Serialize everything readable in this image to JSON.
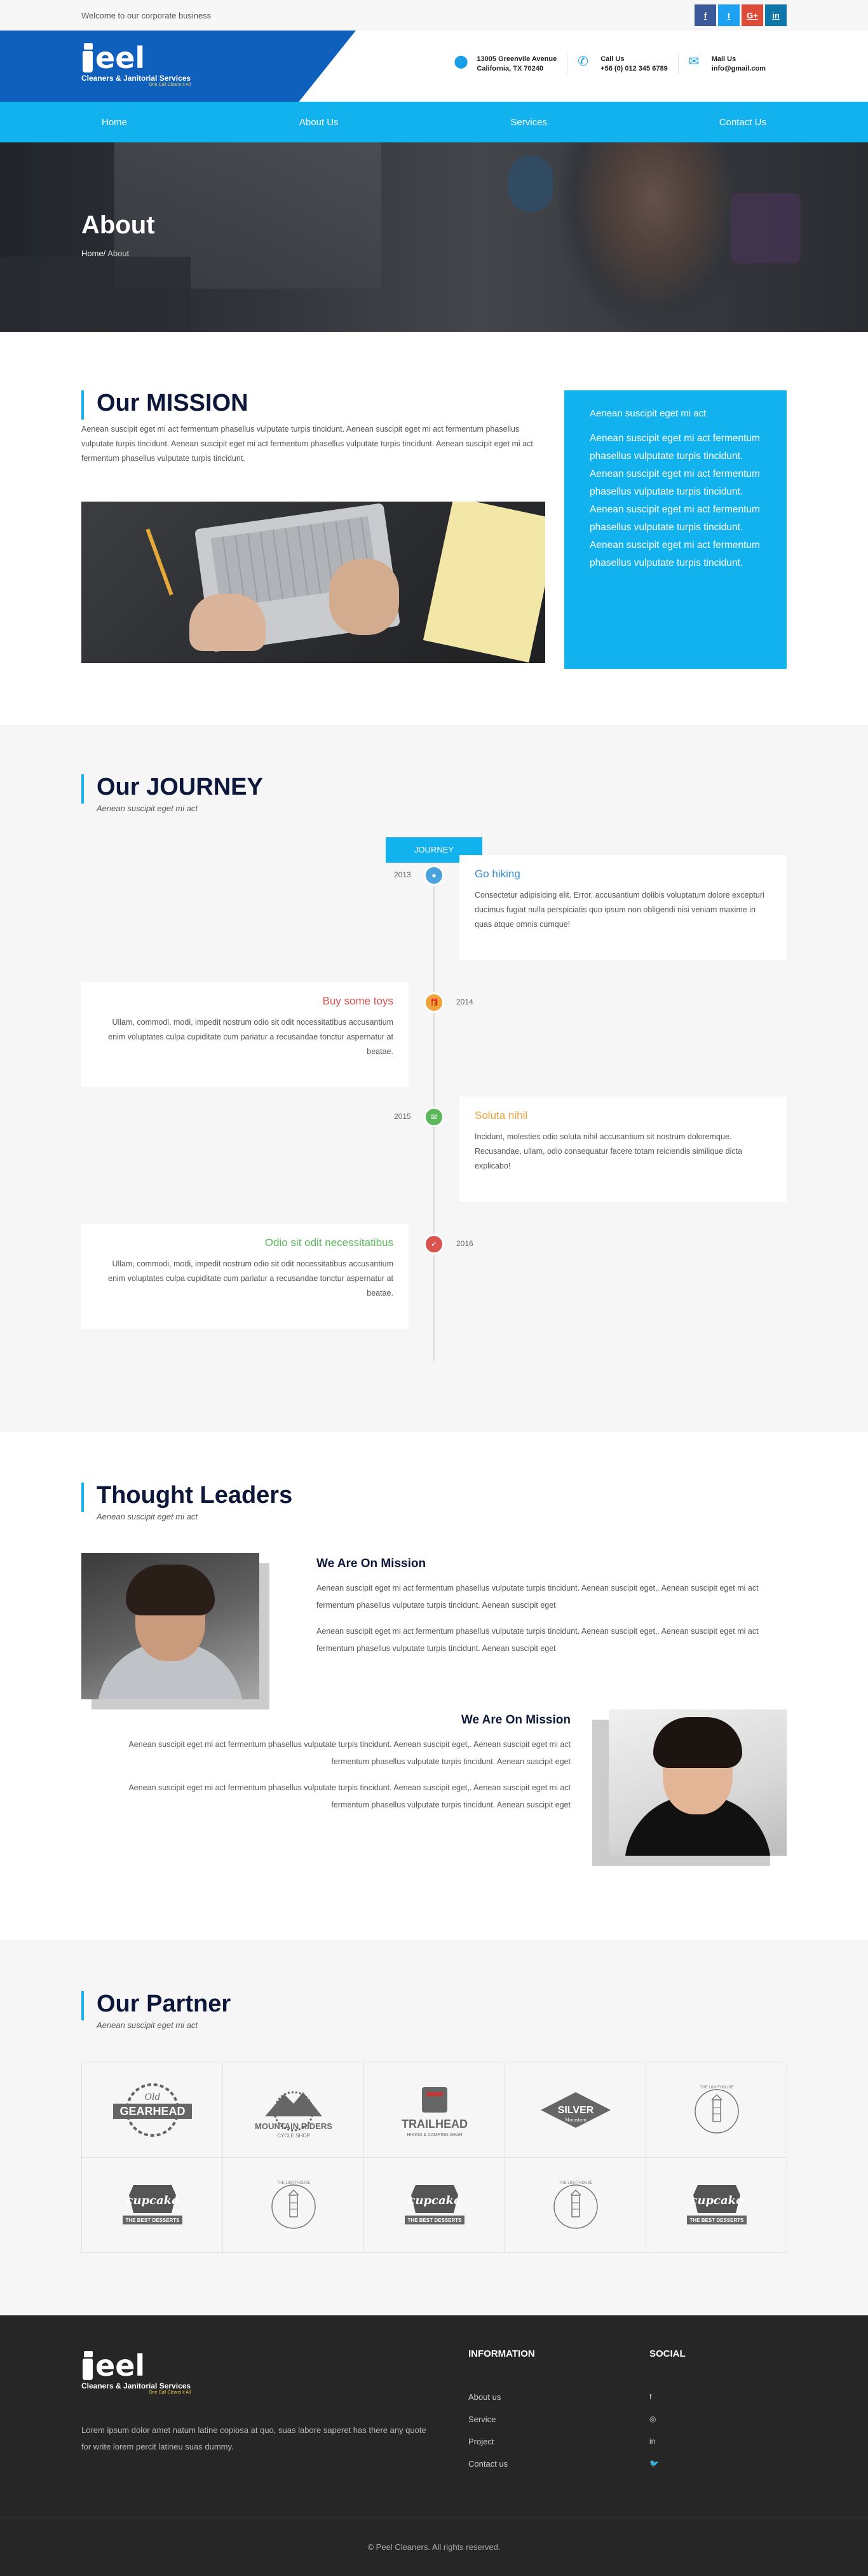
{
  "topbar": {
    "welcome": "Welcome to our corporate business",
    "social": [
      {
        "label": "f",
        "color": "#3b5998"
      },
      {
        "label": "t",
        "color": "#1da1f2"
      },
      {
        "label": "G+",
        "color": "#dd4b39"
      },
      {
        "label": "in",
        "color": "#0e76a8"
      }
    ]
  },
  "logo": {
    "word": "eel",
    "tagline": "Cleaners & Janitorial Services",
    "slogan": "One Call Cleans it All"
  },
  "contacts": [
    {
      "icon": "map-pin-icon",
      "line1": "13005 Greenvile Avenue",
      "line2": "California, TX 70240"
    },
    {
      "icon": "phone-icon",
      "line1": "Call Us",
      "line2": "+56 (0) 012 345 6789"
    },
    {
      "icon": "mail-icon",
      "line1": "Mail Us",
      "line2": "info@gmail.com"
    }
  ],
  "nav": [
    "Home",
    "About Us",
    "Services",
    "Contact Us"
  ],
  "hero": {
    "title": "About",
    "crumb_home": "Home/",
    "crumb_current": " About"
  },
  "mission": {
    "title": "Our MISSION",
    "paragraph": "Aenean suscipit eget mi act fermentum phasellus vulputate turpis tincidunt. Aenean suscipit eget mi act fermentum phasellus vulputate turpis tincidunt. Aenean suscipit eget mi act fermentum phasellus vulputate turpis tincidunt. Aenean suscipit eget mi act fermentum phasellus vulputate turpis tincidunt.",
    "box_heading": "Aenean suscipit eget mi act",
    "box_text": "Aenean suscipit eget mi act fermentum phasellus vulputate turpis tincidunt. Aenean suscipit eget mi act fermentum phasellus vulputate turpis tincidunt. Aenean suscipit eget mi act fermentum phasellus vulputate turpis tincidunt. Aenean suscipit eget mi act fermentum phasellus vulputate turpis tincidunt."
  },
  "journey": {
    "title": "Our JOURNEY",
    "subtitle": "Aenean suscipit eget mi act",
    "button": "JOURNEY",
    "items": [
      {
        "year": "2013",
        "title": "Go hiking",
        "color": "#4aa3df",
        "icon": "circle-icon",
        "text": "Consectetur adipisicing elit. Error, accusantium dolibis voluptatum dolore excepturi ducimus fugiat nulla perspiciatis quo ipsum non obligendi nisi veniam maxime in quas atque omnis cumque!"
      },
      {
        "year": "2014",
        "title": "Buy some toys",
        "color": "#f0a33b",
        "icon": "gift-icon",
        "text": "Ullam, commodi, modi, impedit nostrum odio sit odit nocessitatibus accusantium enim voluptates culpa cupiditate cum pariatur a recusandae tonctur aspernatur at beatae."
      },
      {
        "year": "2015",
        "title": "Soluta nihil",
        "color": "#5cb85c",
        "icon": "chat-icon",
        "text": "Incidunt, molesties odio soluta nihil accusantium sit nostrum doloremque. Recusandae, ullam, odio consequatur facere totam reiciendis similique dicta explicabo!"
      },
      {
        "year": "2016",
        "title": "Odio sit odit necessitatibus",
        "color": "#d9534f",
        "icon": "check-icon",
        "text": "Ullam, commodi, modi, impedit nostrum odio sit odit nocessitatibus accusantium enim voluptates culpa cupiditate cum pariatur a recusandae tonctur aspernatur at beatae."
      }
    ],
    "title_colors": [
      "#3a8ed6",
      "#d9534f",
      "#f0a33b",
      "#5cb85c"
    ]
  },
  "leaders": {
    "title": "Thought Leaders",
    "subtitle": "Aenean suscipit eget mi act",
    "items": [
      {
        "heading": "We Are On Mission",
        "p1": "Aenean suscipit eget mi act fermentum phasellus vulputate turpis tincidunt. Aenean suscipit eget,. Aenean suscipit eget mi act fermentum phasellus vulputate turpis tincidunt. Aenean suscipit eget",
        "p2": "Aenean suscipit eget mi act fermentum phasellus vulputate turpis tincidunt. Aenean suscipit eget,. Aenean suscipit eget mi act fermentum phasellus vulputate turpis tincidunt. Aenean suscipit eget"
      },
      {
        "heading": "We Are On Mission",
        "p1": "Aenean suscipit eget mi act fermentum phasellus vulputate turpis tincidunt. Aenean suscipit eget,. Aenean suscipit eget mi act fermentum phasellus vulputate turpis tincidunt. Aenean suscipit eget",
        "p2": "Aenean suscipit eget mi act fermentum phasellus vulputate turpis tincidunt. Aenean suscipit eget,. Aenean suscipit eget mi act fermentum phasellus vulputate turpis tincidunt. Aenean suscipit eget"
      }
    ]
  },
  "partner": {
    "title": "Our Partner",
    "subtitle": "Aenean suscipit eget mi act",
    "logos": [
      {
        "kind": "gearhead",
        "l1": "Old",
        "l2": "GEARHEAD"
      },
      {
        "kind": "mountain",
        "l1": "MOUNTAIN RIDERS",
        "l2": "CYCLE SHOP"
      },
      {
        "kind": "trailhead",
        "l1": "TRAILHEAD",
        "l2": "HIKING & CAMPING GEAR"
      },
      {
        "kind": "silver",
        "l1": "SILVER",
        "l2": "Mountain"
      },
      {
        "kind": "lighthouse",
        "l1": "THE LIGHTHOUSE",
        "l2": ""
      },
      {
        "kind": "cupcake",
        "l1": "cupcake",
        "l2": "THE BEST DESSERTS"
      },
      {
        "kind": "lighthouse",
        "l1": "THE LIGHTHOUSE",
        "l2": ""
      },
      {
        "kind": "cupcake",
        "l1": "cupcake",
        "l2": "THE BEST DESSERTS"
      },
      {
        "kind": "lighthouse",
        "l1": "THE LIGHTHOUSE",
        "l2": ""
      },
      {
        "kind": "cupcake",
        "l1": "cupcake",
        "l2": "THE BEST DESSERTS"
      }
    ]
  },
  "footer": {
    "description": "Lorem ipsum dolor amet natum latine copiosa at quo, suas labore saperet has there any quote for write lorem percit latineu suas dummy.",
    "info_title": "INFORMATION",
    "info_links": [
      "About us",
      "Service",
      "Project",
      "Contact us"
    ],
    "social_title": "SOCIAL",
    "social_icons": [
      "f",
      "◎",
      "in",
      "🐦"
    ],
    "copyright": "© Peel Cleaners. All rights reserved."
  }
}
